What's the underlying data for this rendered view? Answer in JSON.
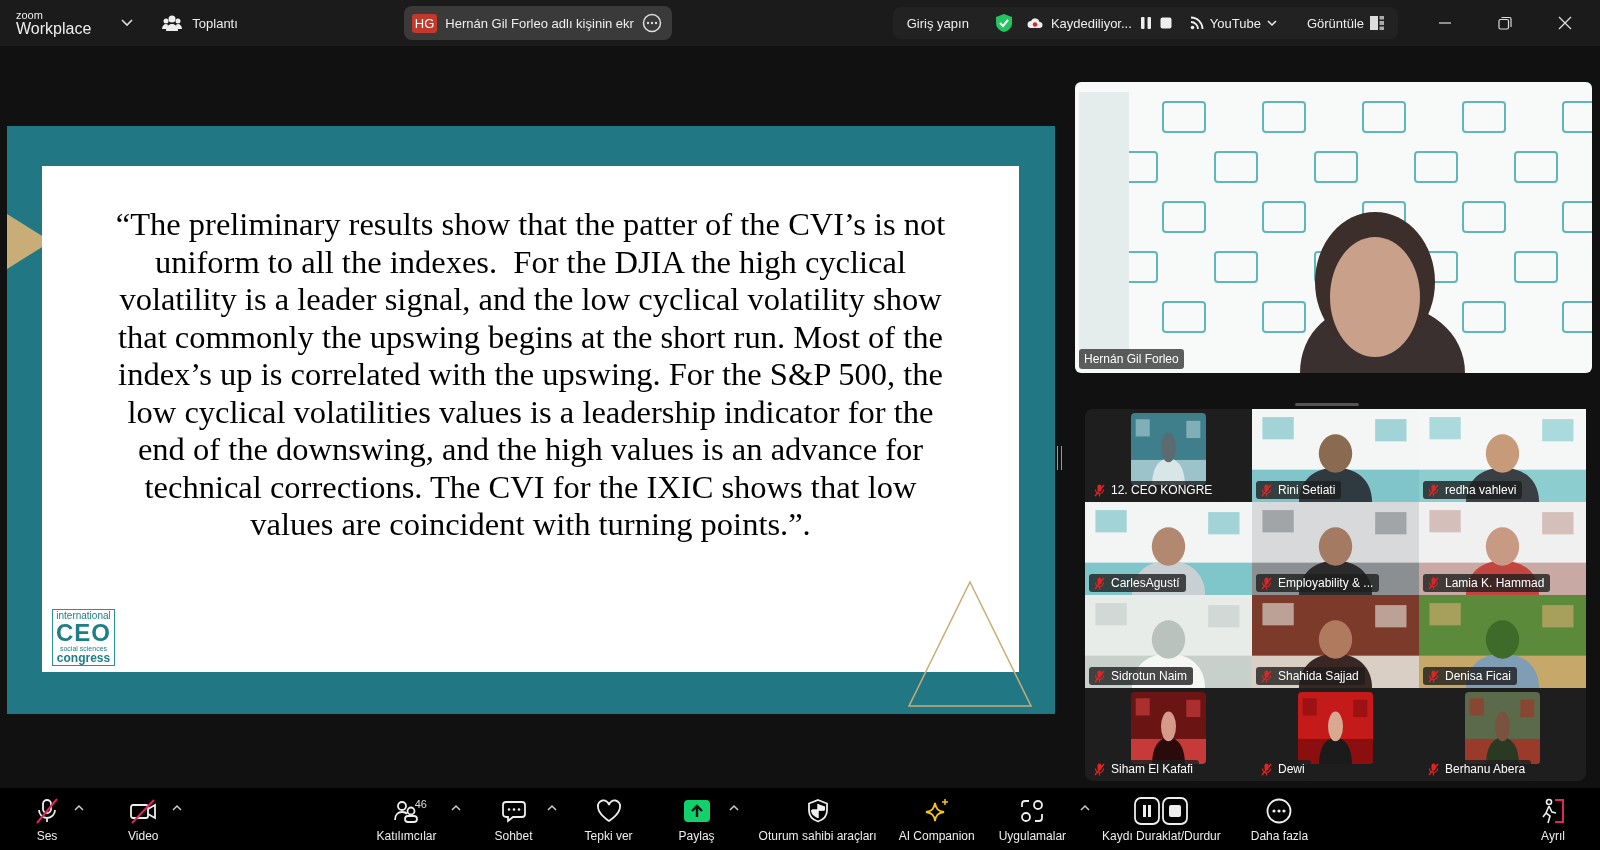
{
  "top_bar": {
    "brand_small": "zoom",
    "brand": "Workplace",
    "meeting_menu": "Toplantı",
    "share_banner": {
      "initials": "HG",
      "text": "Hernán Gil Forleo adlı kişinin ekr"
    },
    "sign_in": "Giriş yapın",
    "recording": "Kaydediliyor...",
    "stream": "YouTube",
    "view": "Görüntüle"
  },
  "slide": {
    "quote": "“The preliminary results show that the patter of the CVI’s is not uniform to all the indexes.  For the DJIA the high cyclical volatility is a leader signal, and the low cyclical volatility show that commonly the upswing begins at the short run. Most of the index’s up is correlated with the upswing. For the S&P 500, the low cyclical volatilities values is a leadership indicator for the end of the downswing, and the high values is an advance for technical corrections. The CVI for the IXIC shows that low values are coincident with turning points.”.",
    "logo": {
      "top": "international",
      "main": "CEO",
      "sub": "social sciences",
      "bottom": "congress"
    }
  },
  "speaker": {
    "name": "Hernán Gil Forleo",
    "kind": "picture"
  },
  "participants": [
    {
      "name": "12. CEO KONGRE",
      "muted": true,
      "kind": "avatar"
    },
    {
      "name": "Rini Setiati",
      "muted": true,
      "kind": "video"
    },
    {
      "name": "redha vahlevi",
      "muted": true,
      "kind": "video"
    },
    {
      "name": "CarlesAgustí",
      "muted": true,
      "kind": "video"
    },
    {
      "name": "Employability & ...",
      "muted": true,
      "kind": "video"
    },
    {
      "name": "Lamia K. Hammad",
      "muted": true,
      "kind": "video"
    },
    {
      "name": "Sidrotun Naim",
      "muted": true,
      "kind": "video"
    },
    {
      "name": "Shahida Sajjad",
      "muted": true,
      "kind": "video"
    },
    {
      "name": "Denisa Ficai",
      "muted": true,
      "kind": "video"
    },
    {
      "name": "Siham El Kafafi",
      "muted": true,
      "kind": "avatar"
    },
    {
      "name": "Dewi",
      "muted": true,
      "kind": "avatar"
    },
    {
      "name": "Berhanu Abera",
      "muted": true,
      "kind": "avatar"
    }
  ],
  "toolbar": [
    {
      "label": "Ses",
      "kind": "mic",
      "off": true,
      "caret": true
    },
    {
      "label": "Video",
      "kind": "camera",
      "off": true,
      "caret": true
    },
    {
      "label": "Katılımcılar",
      "kind": "people",
      "count": "46",
      "caret": true
    },
    {
      "label": "Sohbet",
      "kind": "chat",
      "caret": true
    },
    {
      "label": "Tepki ver",
      "kind": "heart",
      "caret": false
    },
    {
      "label": "Paylaş",
      "kind": "share",
      "caret": true
    },
    {
      "label": "Oturum sahibi araçları",
      "kind": "shield",
      "caret": false
    },
    {
      "label": "AI Companion",
      "kind": "sparkle",
      "caret": false
    },
    {
      "label": "Uygulamalar",
      "kind": "apps",
      "caret": true
    },
    {
      "label": "Kaydı Duraklat/Durdur",
      "kind": "record",
      "caret": false
    },
    {
      "label": "Daha fazla",
      "kind": "more",
      "caret": false
    },
    {
      "label": "Ayrıl",
      "kind": "leave",
      "caret": false
    }
  ]
}
